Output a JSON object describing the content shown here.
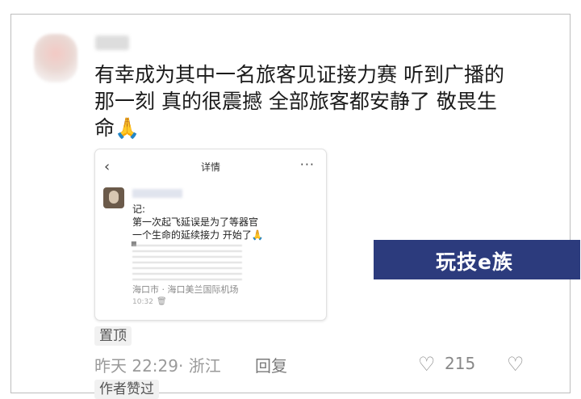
{
  "comment": {
    "username": "",
    "lines": [
      "有幸成为其中一名旅客见证接力赛 听到广播的",
      "那一刻 真的很震撼  全部旅客都安静了  敬畏生",
      "命🙏"
    ]
  },
  "card": {
    "title": "详情",
    "back_icon": "‹",
    "more_icon": "···",
    "post_lines": [
      "记:",
      "第一次起飞延误是为了等器官",
      "一个生命的延续接力 开始了🙏"
    ],
    "location": "海口市 · 海口美兰国际机场",
    "time": "10:32",
    "trash_icon": "🗑"
  },
  "watermark": {
    "text": "玩技e族"
  },
  "footer": {
    "pin_label": "置顶",
    "meta": "昨天 22:29· 浙江",
    "reply_label": "回复",
    "like_icon": "♡",
    "like_count": "215",
    "dislike_icon": "♡",
    "author_label": "作者赞过"
  }
}
